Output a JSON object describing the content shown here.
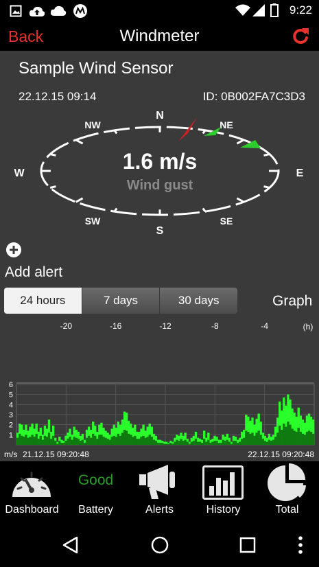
{
  "status_bar": {
    "time": "9:22"
  },
  "header": {
    "back_label": "Back",
    "title": "Windmeter"
  },
  "sensor": {
    "name": "Sample Wind Sensor",
    "date": "22.12.15  09:14",
    "id": "ID: 0B002FA7C3D3"
  },
  "compass": {
    "directions": [
      "N",
      "NE",
      "E",
      "SE",
      "S",
      "SW",
      "W",
      "NW"
    ],
    "value": "1.6 m/s",
    "mode": "Wind gust",
    "needle_color": "#cc2222",
    "marker_color": "#2ecc2e"
  },
  "alert": {
    "label": "Add alert"
  },
  "range_tabs": [
    "24 hours",
    "7 days",
    "30 days"
  ],
  "active_range": "24 hours",
  "graph_label": "Graph",
  "chart_data": {
    "type": "bar",
    "x_ticks": [
      "-20",
      "-16",
      "-12",
      "-8",
      "-4"
    ],
    "x_unit": "(h)",
    "y_ticks": [
      "1",
      "2",
      "3",
      "4",
      "5",
      "6"
    ],
    "ylim": [
      0,
      6
    ],
    "y_unit": "m/s",
    "start_label": "21.12.15  09:20:48",
    "end_label": "22.12.15  09:20:48",
    "bar_color": "#2bff2b",
    "grid": true,
    "gust_values": [
      1.2,
      2.1,
      2.0,
      1.5,
      2.0,
      1.4,
      1.8,
      2.1,
      1.6,
      2.1,
      1.3,
      1.7,
      1.0,
      1.9,
      1.6,
      2.5,
      1.3,
      1.9,
      0.7,
      0.3,
      0.8,
      0.5,
      0.4,
      0.9,
      1.2,
      1.6,
      1.0,
      1.8,
      1.5,
      1.3,
      0.9,
      1.1,
      0.5,
      1.5,
      1.8,
      1.5,
      2.3,
      1.9,
      1.3,
      2.0,
      2.2,
      1.7,
      1.4,
      1.2,
      1.0,
      1.6,
      2.0,
      1.7,
      2.3,
      2.0,
      2.5,
      3.3,
      3.2,
      2.4,
      2.1,
      1.7,
      2.0,
      1.3,
      1.3,
      1.6,
      2.0,
      1.4,
      1.8,
      2.1,
      1.8,
      1.1,
      0.9,
      0.5,
      0.5,
      0.4,
      0.3,
      0.3,
      0.2,
      0.4,
      0.3,
      0.7,
      1.0,
      0.9,
      1.2,
      0.9,
      1.2,
      0.6,
      0.3,
      0.7,
      0.9,
      1.3,
      0.7,
      0.6,
      0.5,
      1.4,
      0.7,
      1.2,
      0.5,
      0.6,
      0.9,
      0.8,
      0.5,
      0.5,
      1.0,
      0.8,
      1.1,
      0.7,
      0.3,
      0.9,
      0.8,
      0.5,
      0.7,
      1.3,
      1.5,
      3.0,
      2.8,
      2.4,
      2.7,
      2.0,
      2.6,
      3.1,
      2.3,
      1.2,
      0.9,
      0.7,
      1.1,
      0.8,
      1.0,
      1.8,
      2.7,
      4.3,
      3.4,
      4.7,
      3.9,
      5.0,
      4.5,
      3.6,
      3.2,
      2.8,
      3.7,
      2.9,
      2.5,
      2.2,
      2.9,
      3.1,
      2.8,
      2.5
    ],
    "avg_values": [
      0.7,
      1.1,
      0.9,
      0.8,
      1.0,
      0.7,
      0.8,
      1.0,
      0.8,
      1.1,
      0.6,
      0.9,
      0.5,
      0.9,
      0.8,
      1.2,
      0.6,
      0.9,
      0.4,
      0.1,
      0.4,
      0.2,
      0.2,
      0.4,
      0.6,
      0.8,
      0.5,
      0.8,
      0.7,
      0.6,
      0.4,
      0.5,
      0.2,
      0.7,
      0.9,
      0.7,
      1.1,
      0.9,
      0.6,
      1.0,
      1.0,
      0.8,
      0.7,
      0.6,
      0.5,
      0.8,
      0.9,
      0.8,
      1.1,
      0.9,
      1.2,
      1.5,
      1.4,
      1.1,
      1.0,
      0.8,
      0.9,
      0.6,
      0.6,
      0.8,
      0.9,
      0.7,
      0.8,
      1.0,
      0.8,
      0.5,
      0.4,
      0.2,
      0.2,
      0.2,
      0.1,
      0.1,
      0.1,
      0.2,
      0.1,
      0.3,
      0.5,
      0.4,
      0.6,
      0.4,
      0.5,
      0.3,
      0.1,
      0.3,
      0.4,
      0.6,
      0.3,
      0.3,
      0.2,
      0.6,
      0.3,
      0.5,
      0.2,
      0.3,
      0.4,
      0.4,
      0.2,
      0.2,
      0.5,
      0.4,
      0.5,
      0.3,
      0.1,
      0.4,
      0.4,
      0.2,
      0.3,
      0.6,
      0.7,
      1.4,
      1.3,
      1.1,
      1.2,
      0.9,
      1.2,
      1.4,
      1.0,
      0.6,
      0.4,
      0.3,
      0.5,
      0.4,
      0.5,
      0.8,
      1.2,
      1.9,
      1.5,
      2.1,
      1.8,
      2.3,
      2.0,
      1.6,
      1.4,
      1.3,
      1.7,
      1.3,
      1.1,
      1.0,
      1.3,
      1.4,
      1.3,
      1.1
    ]
  },
  "nav": [
    {
      "label": "Dashboard",
      "icon": "gauge-icon"
    },
    {
      "label": "Battery",
      "icon": "battery-status",
      "status": "Good"
    },
    {
      "label": "Alerts",
      "icon": "megaphone-icon"
    },
    {
      "label": "History",
      "icon": "bar-chart-icon"
    },
    {
      "label": "Total",
      "icon": "pie-chart-icon"
    }
  ]
}
